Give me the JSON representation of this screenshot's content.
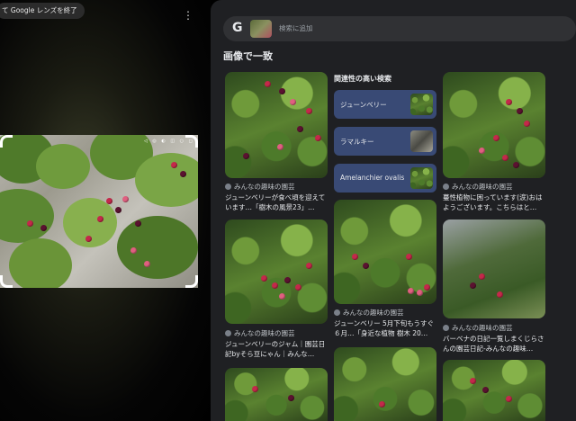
{
  "lens_overlay": {
    "exit_chip_label": "て Google レンズを終了",
    "menu_icon": "kebab-menu-icon"
  },
  "search": {
    "logo": "G",
    "placeholder": "検索に追加"
  },
  "section_title": "画像で一致",
  "related": {
    "title": "関連性の高い検索",
    "items": [
      {
        "label": "ジューンベリー"
      },
      {
        "label": "ラマルキー"
      },
      {
        "label": "Amelanchier ovalis"
      }
    ]
  },
  "results": [
    {
      "source": "みんなの趣味の園芸",
      "title": "ジューンベリーが食べ頃を迎えています…「樹木の風景23」…"
    },
    {
      "source": "みんなの趣味の園芸",
      "title": "蔓性植物に困っています(涙)おはようございます。こちらはと…"
    },
    {
      "source": "みんなの趣味の園芸",
      "title": "ジューンベリーのジャム｜園芸日記byそら豆にゃん｜みんな…"
    },
    {
      "source": "みんなの趣味の園芸",
      "title": "ジューンベリー 5月下旬もうすぐ６月…「身近な植物 樹木 20…"
    },
    {
      "source": "みんなの趣味の園芸",
      "title": "バーベナの日記一覧しまくじらさんの園芸日記-みんなの趣味…"
    }
  ]
}
